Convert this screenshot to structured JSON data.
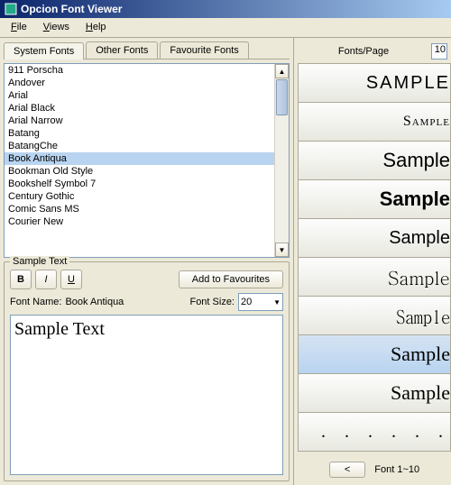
{
  "title": "Opcion Font Viewer",
  "menu": {
    "file": "File",
    "views": "Views",
    "help": "Help"
  },
  "tabs": {
    "system": "System Fonts",
    "other": "Other Fonts",
    "favourite": "Favourite Fonts"
  },
  "font_list": [
    "911 Porscha",
    "Andover",
    "Arial",
    "Arial Black",
    "Arial Narrow",
    "Batang",
    "BatangChe",
    "Book Antiqua",
    "Bookman Old Style",
    "Bookshelf Symbol 7",
    "Century Gothic",
    "Comic Sans MS",
    "Courier New"
  ],
  "selected_font_index": 7,
  "sample": {
    "group_title": "Sample Text",
    "bold": "B",
    "italic": "I",
    "underline": "U",
    "add_fav": "Add to Favourites",
    "font_name_label": "Font Name:",
    "font_name_value": "Book Antiqua",
    "font_size_label": "Font Size:",
    "font_size_value": "20",
    "text": "Sample Text"
  },
  "right": {
    "header_label": "Fonts/Page",
    "header_value": "10",
    "previews": [
      {
        "text": "SAMPLE",
        "cls": "f-911"
      },
      {
        "text": "Sample",
        "cls": "f-andover"
      },
      {
        "text": "Sample",
        "cls": "f-arial"
      },
      {
        "text": "Sample",
        "cls": "f-arialblack"
      },
      {
        "text": "Sample",
        "cls": "f-arialnarrow"
      },
      {
        "text": "Sample",
        "cls": "f-batang"
      },
      {
        "text": "Sample",
        "cls": "f-batangche"
      },
      {
        "text": "Sample",
        "cls": "f-bookantiqua"
      },
      {
        "text": "Sample",
        "cls": "f-bookman"
      },
      {
        "text": ". . . . . .",
        "cls": "f-bookshelf"
      }
    ],
    "selected_preview_index": 7,
    "nav_prev": "<",
    "range": "Font 1~10"
  }
}
